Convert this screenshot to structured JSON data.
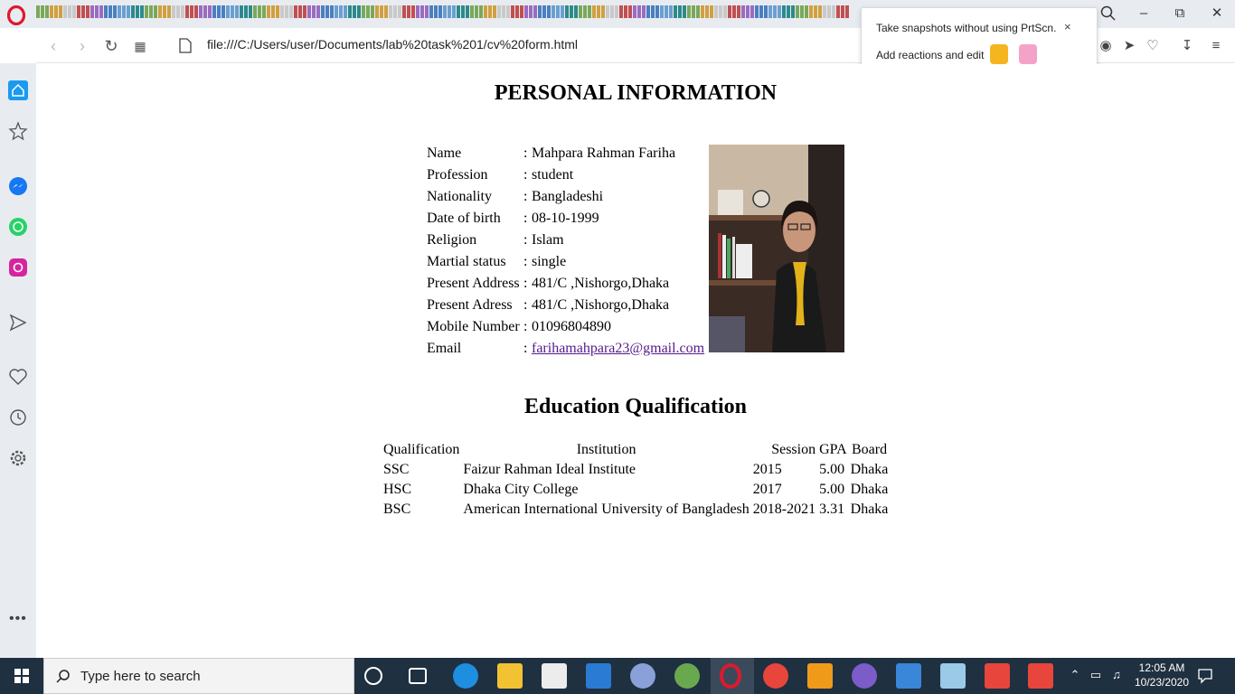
{
  "browser": {
    "url": "file:///C:/Users/user/Documents/lab%20task%201/cv%20form.html"
  },
  "popup": {
    "line1": "Take snapshots without using PrtScn.",
    "line2": "Add reactions and edit",
    "close": "×"
  },
  "page": {
    "title": "PERSONAL INFORMATION",
    "info": [
      {
        "label": "Name",
        "sep": ":",
        "value": "Mahpara Rahman Fariha"
      },
      {
        "label": "Profession",
        "sep": ":",
        "value": "student"
      },
      {
        "label": "Nationality",
        "sep": ":",
        "value": "Bangladeshi"
      },
      {
        "label": "Date of birth",
        "sep": ":",
        "value": "08-10-1999"
      },
      {
        "label": "Religion",
        "sep": ":",
        "value": "Islam"
      },
      {
        "label": "Martial status",
        "sep": ":",
        "value": "single"
      },
      {
        "label": "Present Address",
        "sep": ":",
        "value": "481/C ,Nishorgo,Dhaka"
      },
      {
        "label": "Present Adress",
        "sep": ":",
        "value": "481/C ,Nishorgo,Dhaka"
      },
      {
        "label": "Mobile Number",
        "sep": ":",
        "value": "01096804890"
      },
      {
        "label": "Email",
        "sep": ":",
        "value": "farihamahpara23@gmail.com"
      }
    ],
    "education_title": "Education Qualification",
    "education": {
      "headers": [
        "Qualification",
        "Institution",
        "Session",
        "GPA",
        "Board"
      ],
      "rows": [
        [
          "SSC",
          "Faizur Rahman Ideal Institute",
          "2015",
          "5.00",
          "Dhaka"
        ],
        [
          "HSC",
          "Dhaka City College",
          "2017",
          "5.00",
          "Dhaka"
        ],
        [
          "BSC",
          "American International University of Bangladesh",
          "2018-2021",
          "3.31",
          "Dhaka"
        ]
      ]
    }
  },
  "taskbar": {
    "search_placeholder": "Type here to search",
    "time": "12:05 AM",
    "date": "10/23/2020"
  },
  "colors": {
    "opera_red": "#e0182d",
    "sidebar_blue": "#1a9bf0",
    "taskbar_bg": "#1f3040",
    "link_visited": "#551a8b"
  }
}
